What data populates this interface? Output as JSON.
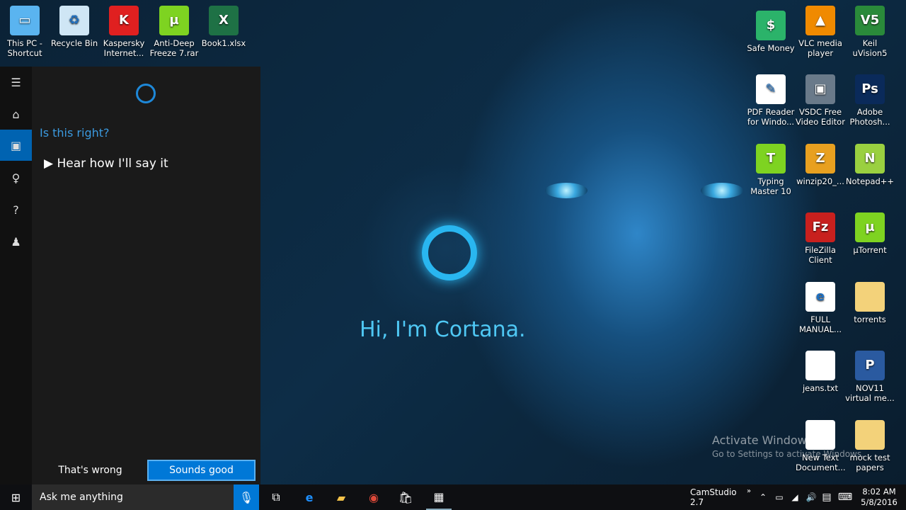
{
  "desktop": {
    "left_icons": [
      {
        "label": "This PC - Shortcut",
        "icon": "computer-icon",
        "color": "#5ab4f0",
        "glyph": "▭"
      },
      {
        "label": "Recycle Bin",
        "icon": "recycle-bin-icon",
        "color": "#cfe6f5",
        "glyph": "♻"
      },
      {
        "label": "Kaspersky Internet...",
        "icon": "kaspersky-icon",
        "color": "#e02020",
        "glyph": "K"
      },
      {
        "label": "Anti-Deep Freeze 7.rar",
        "icon": "utorrent-icon",
        "color": "#7ed321",
        "glyph": "µ"
      },
      {
        "label": "Book1.xlsx",
        "icon": "excel-icon",
        "color": "#1e7145",
        "glyph": "X"
      }
    ],
    "right_icons": [
      {
        "label": "Safe Money",
        "icon": "safe-money-icon",
        "color": "#2bb36a",
        "glyph": "$"
      },
      {
        "label": "VLC media player",
        "icon": "vlc-icon",
        "color": "#f08a00",
        "glyph": "▲"
      },
      {
        "label": "Keil uVision5",
        "icon": "keil-icon",
        "color": "#2a8a3a",
        "glyph": "V5"
      },
      {
        "label": "PDF Reader for Windo...",
        "icon": "pdf-reader-icon",
        "color": "#ffffff",
        "glyph": "✎"
      },
      {
        "label": "VSDC Free Video Editor",
        "icon": "vsdc-icon",
        "color": "#6a7a8a",
        "glyph": "▣"
      },
      {
        "label": "Adobe Photosh...",
        "icon": "photoshop-icon",
        "color": "#0a2a5a",
        "glyph": "Ps"
      },
      {
        "label": "Typing Master 10",
        "icon": "typing-master-icon",
        "color": "#7ed321",
        "glyph": "T"
      },
      {
        "label": "winzip20_...",
        "icon": "winzip-icon",
        "color": "#e8a020",
        "glyph": "Z"
      },
      {
        "label": "Notepad++",
        "icon": "notepadpp-icon",
        "color": "#9ad040",
        "glyph": "N"
      },
      {
        "label": "FileZilla Client",
        "icon": "filezilla-icon",
        "color": "#c8201e",
        "glyph": "Fz"
      },
      {
        "label": "µTorrent",
        "icon": "utorrent-icon",
        "color": "#7ed321",
        "glyph": "µ"
      },
      {
        "label": "FULL MANUAL...",
        "icon": "pdf-edge-icon",
        "color": "#ffffff",
        "glyph": "e"
      },
      {
        "label": "torrents",
        "icon": "folder-icon",
        "color": "#f3d27a",
        "glyph": ""
      },
      {
        "label": "jeans.txt",
        "icon": "text-file-icon",
        "color": "#ffffff",
        "glyph": ""
      },
      {
        "label": "NOV11 virtual me...",
        "icon": "powerpoint-icon",
        "color": "#2a5aa0",
        "glyph": "P"
      },
      {
        "label": "New Text Document...",
        "icon": "text-file-icon",
        "color": "#ffffff",
        "glyph": ""
      },
      {
        "label": "mock test papers",
        "icon": "folder-icon",
        "color": "#f3d27a",
        "glyph": ""
      }
    ],
    "greeting": "Hi, I'm Cortana.",
    "activate_title": "Activate Windows",
    "activate_sub": "Go to Settings to activate Windows."
  },
  "cortana": {
    "question": "Is this right?",
    "hear_label": "Hear how I'll say it",
    "wrong_label": "That's wrong",
    "good_label": "Sounds good",
    "accent": "#0078d7"
  },
  "taskbar": {
    "search_placeholder": "Ask me anything",
    "camstudio": "CamStudio 2.7",
    "overflow": "»",
    "time": "8:02 AM",
    "date": "5/8/2016"
  }
}
